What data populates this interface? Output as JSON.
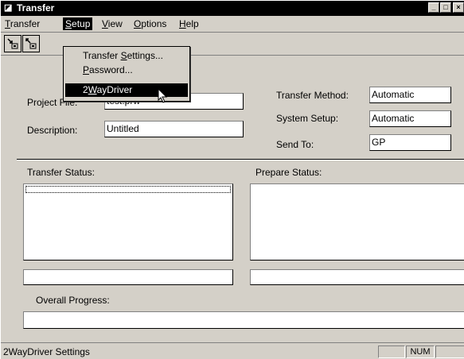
{
  "window": {
    "title": "Transfer",
    "minimize": "_",
    "maximize": "□",
    "close": "×"
  },
  "menu": [
    {
      "label": "Transfer",
      "mnemonic": "T",
      "rest": "ransfer"
    },
    {
      "label": "Setup",
      "mnemonic": "S",
      "rest": "etup"
    },
    {
      "label": "View",
      "mnemonic": "V",
      "rest": "iew"
    },
    {
      "label": "Options",
      "mnemonic": "O",
      "rest": "ptions"
    },
    {
      "label": "Help",
      "mnemonic": "H",
      "rest": "elp"
    }
  ],
  "setup_menu": {
    "items": [
      {
        "label": "Transfer Settings...",
        "pre": "Transfer ",
        "mnemonic": "S",
        "rest": "ettings..."
      },
      {
        "label": "Password...",
        "pre": "",
        "mnemonic": "P",
        "rest": "assword..."
      },
      {
        "label": "2WayDriver",
        "pre": "2",
        "mnemonic": "W",
        "rest": "ayDriver"
      }
    ],
    "highlighted_index": 2
  },
  "form": {
    "project_file_label": "Project File:",
    "project_file_value": "test.prw",
    "description_label": "Description:",
    "description_value": "Untitled",
    "transfer_method_label": "Transfer Method:",
    "transfer_method_value": "Automatic",
    "system_setup_label": "System Setup:",
    "system_setup_value": "Automatic",
    "send_to_label": "Send To:",
    "send_to_value": "GP"
  },
  "status": {
    "transfer_status_label": "Transfer Status:",
    "prepare_status_label": "Prepare Status:",
    "overall_progress_label": "Overall Progress:"
  },
  "statusbar": {
    "text": "2WayDriver Settings",
    "num": "NUM"
  }
}
